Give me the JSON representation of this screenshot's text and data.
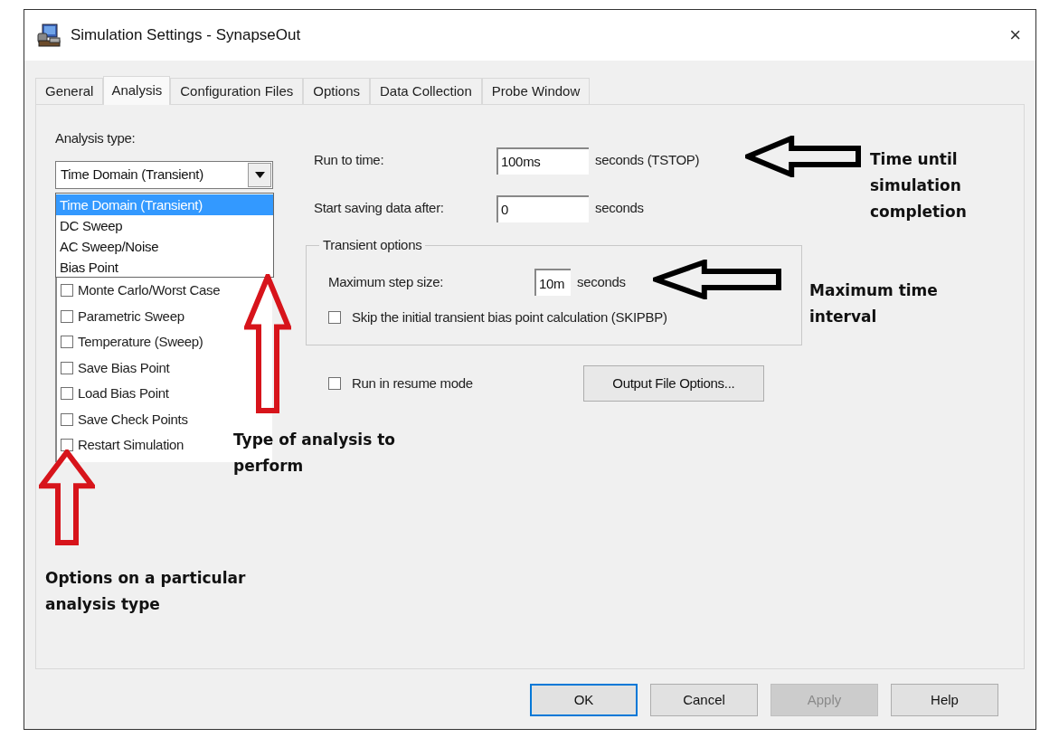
{
  "window": {
    "title": "Simulation Settings - SynapseOut",
    "close": "×"
  },
  "tabs": [
    {
      "label": "General",
      "selected": false
    },
    {
      "label": "Analysis",
      "selected": true
    },
    {
      "label": "Configuration Files",
      "selected": false
    },
    {
      "label": "Options",
      "selected": false
    },
    {
      "label": "Data Collection",
      "selected": false
    },
    {
      "label": "Probe Window",
      "selected": false
    }
  ],
  "analysis_type": {
    "label": "Analysis type:",
    "value": "Time Domain (Transient)",
    "dropdown_options": [
      {
        "label": "Time Domain (Transient)",
        "selected": true
      },
      {
        "label": "DC Sweep",
        "selected": false
      },
      {
        "label": "AC Sweep/Noise",
        "selected": false
      },
      {
        "label": "Bias Point",
        "selected": false
      }
    ]
  },
  "options_list": [
    {
      "label": "Monte Carlo/Worst Case",
      "checked": false
    },
    {
      "label": "Parametric Sweep",
      "checked": false
    },
    {
      "label": "Temperature (Sweep)",
      "checked": false
    },
    {
      "label": "Save Bias Point",
      "checked": false
    },
    {
      "label": "Load Bias Point",
      "checked": false
    },
    {
      "label": "Save Check Points",
      "checked": false
    },
    {
      "label": "Restart Simulation",
      "checked": false
    }
  ],
  "run_to_time": {
    "label": "Run to time:",
    "value": "100ms",
    "unit": "seconds  (TSTOP)"
  },
  "start_saving": {
    "label": "Start saving data after:",
    "value": "0",
    "unit": "seconds"
  },
  "transient_options": {
    "title": "Transient options",
    "max_step": {
      "label": "Maximum step size:",
      "value": "10m",
      "unit": "seconds"
    },
    "skip_bias": {
      "label": "Skip the initial transient bias point calculation  (SKIPBP)",
      "checked": false
    }
  },
  "resume_mode": {
    "label": "Run in resume mode",
    "checked": false
  },
  "output_file_button": "Output File Options...",
  "buttons": [
    {
      "label": "OK",
      "default": true,
      "disabled": false
    },
    {
      "label": "Cancel",
      "default": false,
      "disabled": false
    },
    {
      "label": "Apply",
      "default": false,
      "disabled": true
    },
    {
      "label": "Help",
      "default": false,
      "disabled": false
    }
  ],
  "annotations": [
    {
      "text": "Time until simulation completion",
      "color": "#000000"
    },
    {
      "text": "Maximum time interval",
      "color": "#000000"
    },
    {
      "text": "Type of analysis to perform",
      "color": "#d7141b"
    },
    {
      "text": "Options on a particular analysis type",
      "color": "#d7141b"
    }
  ]
}
